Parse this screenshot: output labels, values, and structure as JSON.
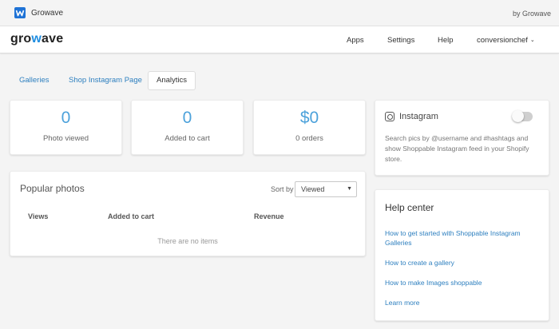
{
  "app": {
    "name": "Growave",
    "byline": "by Growave"
  },
  "nav": {
    "brand_prefix": "gro",
    "brand_w": "w",
    "brand_suffix": "ave",
    "items": [
      "Apps",
      "Settings",
      "Help"
    ],
    "account": "conversionchef"
  },
  "tabs": [
    "Galleries",
    "Shop Instagram Page",
    "Analytics"
  ],
  "stats": [
    {
      "value": "0",
      "label": "Photo viewed"
    },
    {
      "value": "0",
      "label": "Added to cart"
    },
    {
      "value": "$0",
      "label": "0 orders"
    }
  ],
  "popular": {
    "title": "Popular photos",
    "sort_label": "Sort by",
    "sort_value": "Viewed",
    "columns": [
      "Views",
      "Added to cart",
      "Revenue"
    ],
    "empty": "There are no items"
  },
  "instagram": {
    "title": "Instagram",
    "enabled": false,
    "description": "Search pics by @username and #hashtags and show Shoppable Instagram feed in your Shopify store."
  },
  "help": {
    "title": "Help center",
    "links": [
      "How to get started with Shoppable Instagram Galleries",
      "How to create a gallery",
      "How to make Images shoppable",
      "Learn more"
    ]
  },
  "colors": {
    "accent": "#4da2db",
    "link": "#2d7fbf",
    "logo": "#1f73d6"
  }
}
